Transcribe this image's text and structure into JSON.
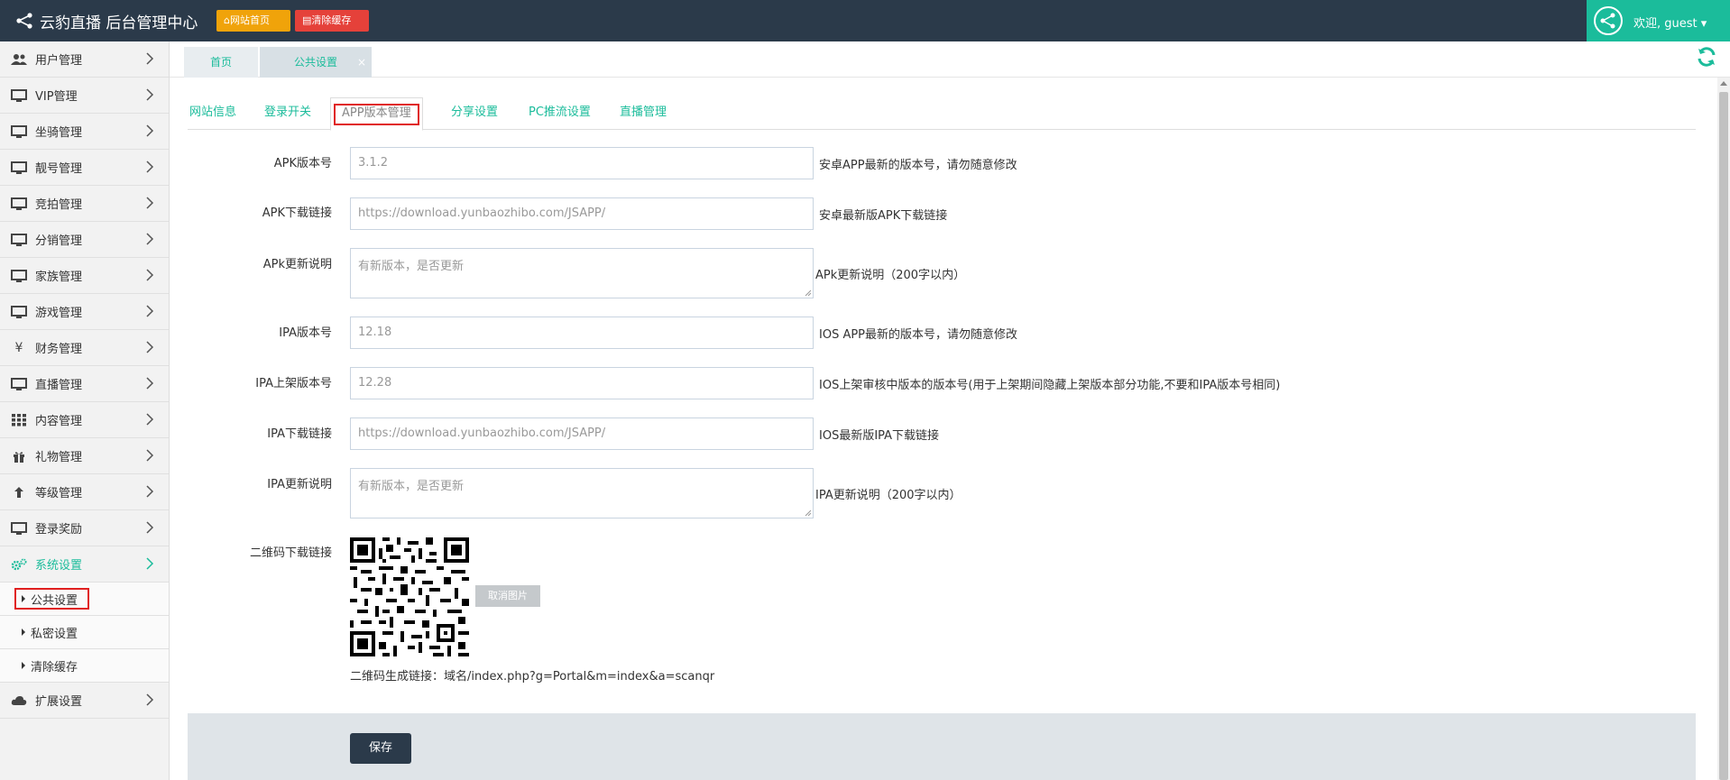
{
  "header": {
    "title": "云豹直播 后台管理中心",
    "home_button": "网站首页",
    "clear_cache_button": "清除缓存",
    "welcome": "欢迎, guest"
  },
  "sidebar": {
    "items": [
      {
        "label": "用户管理",
        "icon": "users-icon"
      },
      {
        "label": "VIP管理",
        "icon": "monitor-icon"
      },
      {
        "label": "坐骑管理",
        "icon": "monitor-icon"
      },
      {
        "label": "靓号管理",
        "icon": "monitor-icon"
      },
      {
        "label": "竞拍管理",
        "icon": "monitor-icon"
      },
      {
        "label": "分销管理",
        "icon": "monitor-icon"
      },
      {
        "label": "家族管理",
        "icon": "monitor-icon"
      },
      {
        "label": "游戏管理",
        "icon": "monitor-icon"
      },
      {
        "label": "财务管理",
        "icon": "yen-icon"
      },
      {
        "label": "直播管理",
        "icon": "monitor-icon"
      },
      {
        "label": "内容管理",
        "icon": "grid-icon"
      },
      {
        "label": "礼物管理",
        "icon": "gift-icon"
      },
      {
        "label": "等级管理",
        "icon": "level-up-icon"
      },
      {
        "label": "登录奖励",
        "icon": "monitor-icon"
      },
      {
        "label": "系统设置",
        "icon": "cogs-icon"
      }
    ],
    "sub_items": [
      "公共设置",
      "私密设置",
      "清除缓存"
    ],
    "extension": {
      "label": "扩展设置",
      "icon": "cloud-icon"
    }
  },
  "page_tabs": {
    "home": "首页",
    "settings": "公共设置",
    "close": "×"
  },
  "sub_tabs": [
    "网站信息",
    "登录开关",
    "APP版本管理",
    "分享设置",
    "PC推流设置",
    "直播管理"
  ],
  "form": {
    "apk_version": {
      "label": "APK版本号",
      "value": "3.1.2",
      "hint": "安卓APP最新的版本号，请勿随意修改"
    },
    "apk_download": {
      "label": "APK下载链接",
      "value": "https://download.yunbaozhibo.com/JSAPP/",
      "hint": "安卓最新版APK下载链接"
    },
    "apk_notes": {
      "label": "APk更新说明",
      "value": "有新版本，是否更新",
      "hint": "APk更新说明（200字以内）"
    },
    "ipa_version": {
      "label": "IPA版本号",
      "value": "12.18",
      "hint": "IOS APP最新的版本号，请勿随意修改"
    },
    "ipa_review_version": {
      "label": "IPA上架版本号",
      "value": "12.28",
      "hint": "IOS上架审核中版本的版本号(用于上架期间隐藏上架版本部分功能,不要和IPA版本号相同)"
    },
    "ipa_download": {
      "label": "IPA下载链接",
      "value": "https://download.yunbaozhibo.com/JSAPP/",
      "hint": "IOS最新版IPA下载链接"
    },
    "ipa_notes": {
      "label": "IPA更新说明",
      "value": "有新版本，是否更新",
      "hint": "IPA更新说明（200字以内）"
    },
    "qr": {
      "label": "二维码下载链接",
      "cancel_button": "取消图片",
      "link_text": "二维码生成链接：域名/index.php?g=Portal&m=index&a=scanqr"
    },
    "save_button": "保存"
  },
  "colors": {
    "header_bg": "#2b3a4a",
    "accent": "#1bbc9b",
    "home_btn": "#f0a30a",
    "clear_btn": "#e5413a",
    "highlight": "#e02020"
  }
}
